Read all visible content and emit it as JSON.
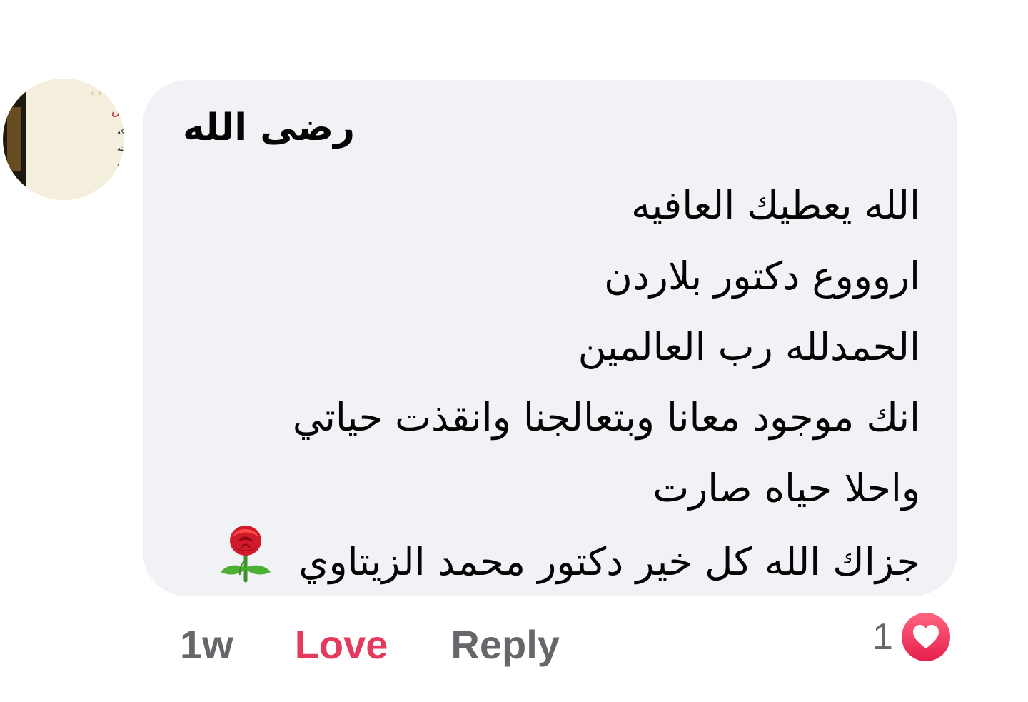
{
  "avatar": {
    "text_lines": [
      "اعقل الناس",
      "من ترك الدنيا قبل أن تتركه",
      "وأتاه قبره قبل أن يسكنه",
      "أرضى ربه قبل أن يلقاه",
      "الدنيه قبل أن يفارقه"
    ]
  },
  "comment": {
    "author": "رضى الله",
    "lines": [
      "الله يعطيك العافيه",
      "اروووع دكتور بلاردن",
      "الحمدلله رب العالمين",
      "انك موجود معانا وبتعالجنا وانقذت حياتي",
      "واحلا حياه صارت",
      "جزاك الله كل خير دكتور محمد الزيتاوي"
    ],
    "emoji": "rose-emoji"
  },
  "actions": {
    "time": "1w",
    "love_label": "Love",
    "reply_label": "Reply"
  },
  "reactions": {
    "count": "1",
    "icon": "heart-icon",
    "badge_color": "#f33e58"
  },
  "colors": {
    "bubble": "#f0f2f5",
    "love_accent": "#e43a5e",
    "muted": "#65676b"
  }
}
